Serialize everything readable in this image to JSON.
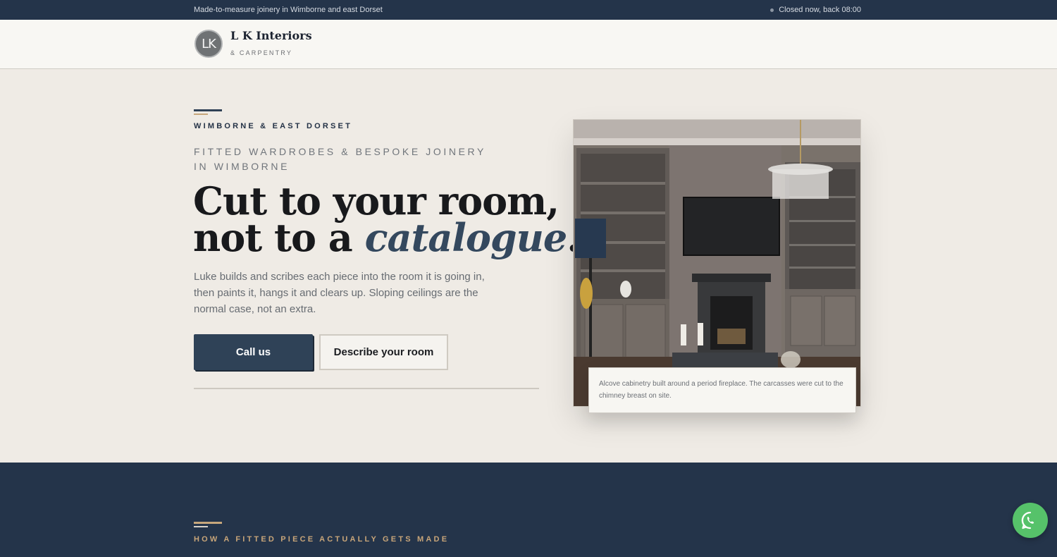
{
  "topbar": {
    "tagline": "Made-to-measure joinery in Wimborne and east Dorset",
    "status": "Closed now, back 08:00"
  },
  "brand": {
    "monogram": "LK",
    "name": "L K Interiors",
    "sub": "& CARPENTRY"
  },
  "hero": {
    "kicker": "WIMBORNE & EAST DORSET",
    "subhead": "FITTED WARDROBES & BESPOKE JOINERY IN WIMBORNE",
    "headline_line1": "Cut to your room,",
    "headline_line2_start": "not to a ",
    "headline_emphasis": "catalogue",
    "headline_end": ".",
    "intro": "Luke builds and scribes each piece into the room it is going in, then paints it, hangs it and clears up. Sloping ceilings are the normal case, not an extra.",
    "call_label": "Call us",
    "describe_label": "Describe your room"
  },
  "photo": {
    "caption": "Alcove cabinetry built around a period fireplace. The carcasses were cut to the chimney breast on site."
  },
  "next_section": {
    "kicker": "HOW A FITTED PIECE ACTUALLY GETS MADE"
  },
  "colors": {
    "navy": "#24344a",
    "accent_gold": "#c7a77c",
    "whatsapp_green": "#56c26a"
  },
  "icons": {
    "status": "status-dot-icon",
    "whatsapp": "whatsapp-icon"
  }
}
